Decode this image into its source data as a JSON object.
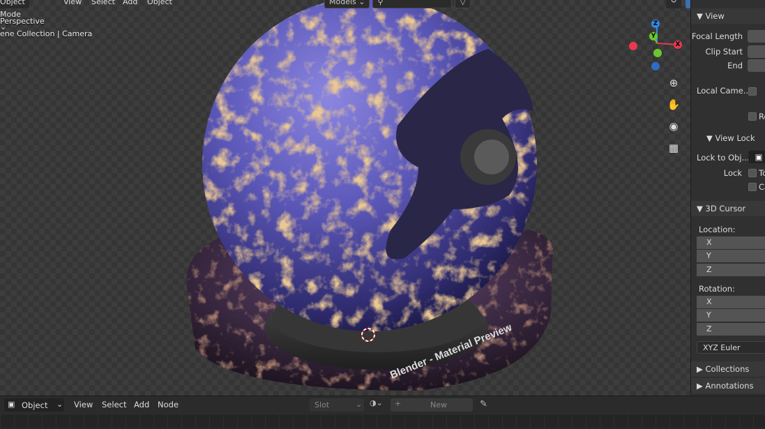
{
  "viewport": {
    "mode_label": "Object Mode",
    "menu": [
      "View",
      "Select",
      "Add",
      "Object"
    ],
    "overlay_line1": "Perspective",
    "overlay_line2": "ene Collection | Camera",
    "shading_dropdown": "Models",
    "gizmo": {
      "z": "Z",
      "y": "Y",
      "x": "X"
    },
    "preview_text": "Blender - Material Preview"
  },
  "sidebar": {
    "view_header": "View",
    "focal_length": "Focal Length",
    "clip_start": "Clip Start",
    "end": "End",
    "local_camera": "Local Came...",
    "re_label": "Re",
    "view_lock_header": "View Lock",
    "lock_to_object": "Lock to Obj...",
    "lock": "Lock",
    "lock_to_short": "To",
    "lock_ca_short": "Ca",
    "cursor_header": "3D Cursor",
    "location_label": "Location:",
    "rotation_label": "Rotation:",
    "axis_x": "X",
    "axis_y": "Y",
    "axis_z": "Z",
    "rotation_mode": "XYZ Euler",
    "collections": "Collections",
    "annotations": "Annotations"
  },
  "bottom": {
    "editor_mode": "Object",
    "menu": [
      "View",
      "Select",
      "Add",
      "Node"
    ],
    "slot": "Slot",
    "new_label": "New"
  },
  "colors": {
    "x_axis": "#e8394d",
    "y_axis": "#6bc72b",
    "z_axis": "#2d8ceb",
    "sphere_purple": "#5a56b8",
    "rust_orange": "#d0914a"
  }
}
